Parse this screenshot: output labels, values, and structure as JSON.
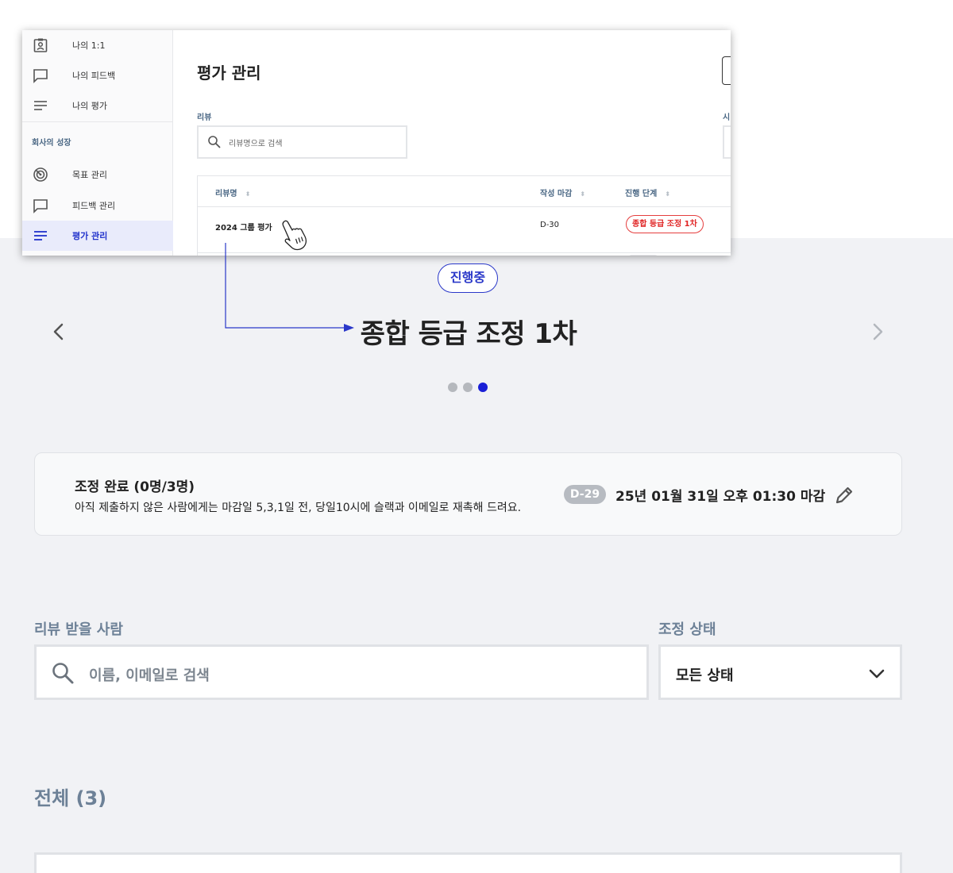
{
  "inset": {
    "sidebar": {
      "items": [
        {
          "label": "나의 1:1",
          "icon": "contact-card-icon"
        },
        {
          "label": "나의 피드백",
          "icon": "speech-bubble-icon"
        },
        {
          "label": "나의 평가",
          "icon": "list-lines-icon"
        }
      ],
      "section_title": "회사의 성장",
      "company_items": [
        {
          "label": "목표 관리",
          "icon": "target-icon"
        },
        {
          "label": "피드백 관리",
          "icon": "speech-bubble-icon"
        },
        {
          "label": "평가 관리",
          "icon": "list-lines-icon",
          "active": true
        }
      ]
    },
    "page_title": "평가 관리",
    "review_label": "리뷰",
    "cut_label": "시",
    "search_placeholder": "리뷰명으로 검색",
    "table": {
      "headers": [
        "리뷰명",
        "작성 마감",
        "진행 단계"
      ],
      "rows": [
        {
          "name": "2024 그룹 평가",
          "deadline": "D-30",
          "stage": "종합 등급 조정 1차"
        }
      ]
    }
  },
  "carousel": {
    "status": "진행중",
    "title": "종합 등급 조정 1차",
    "dots": 3,
    "active_dot": 3
  },
  "info": {
    "title": "조정 완료 (0명/3명)",
    "description": "아직 제출하지 않은 사람에게는 마감일 5,3,1일 전, 당일10시에 슬랙과 이메일로 재촉해 드려요.",
    "dday": "D-29",
    "deadline": "25년 01월 31일 오후 01:30 마감"
  },
  "filters": {
    "reviewee_label": "리뷰 받을 사람",
    "search_placeholder": "이름, 이메일로 검색",
    "status_label": "조정 상태",
    "status_value": "모든 상태"
  },
  "list": {
    "total": "전체 (3)"
  },
  "colors": {
    "accent": "#2a38c9",
    "active_dot": "#1a1fd6",
    "stage_red": "#e02424",
    "label_slate": "#6d8197"
  }
}
